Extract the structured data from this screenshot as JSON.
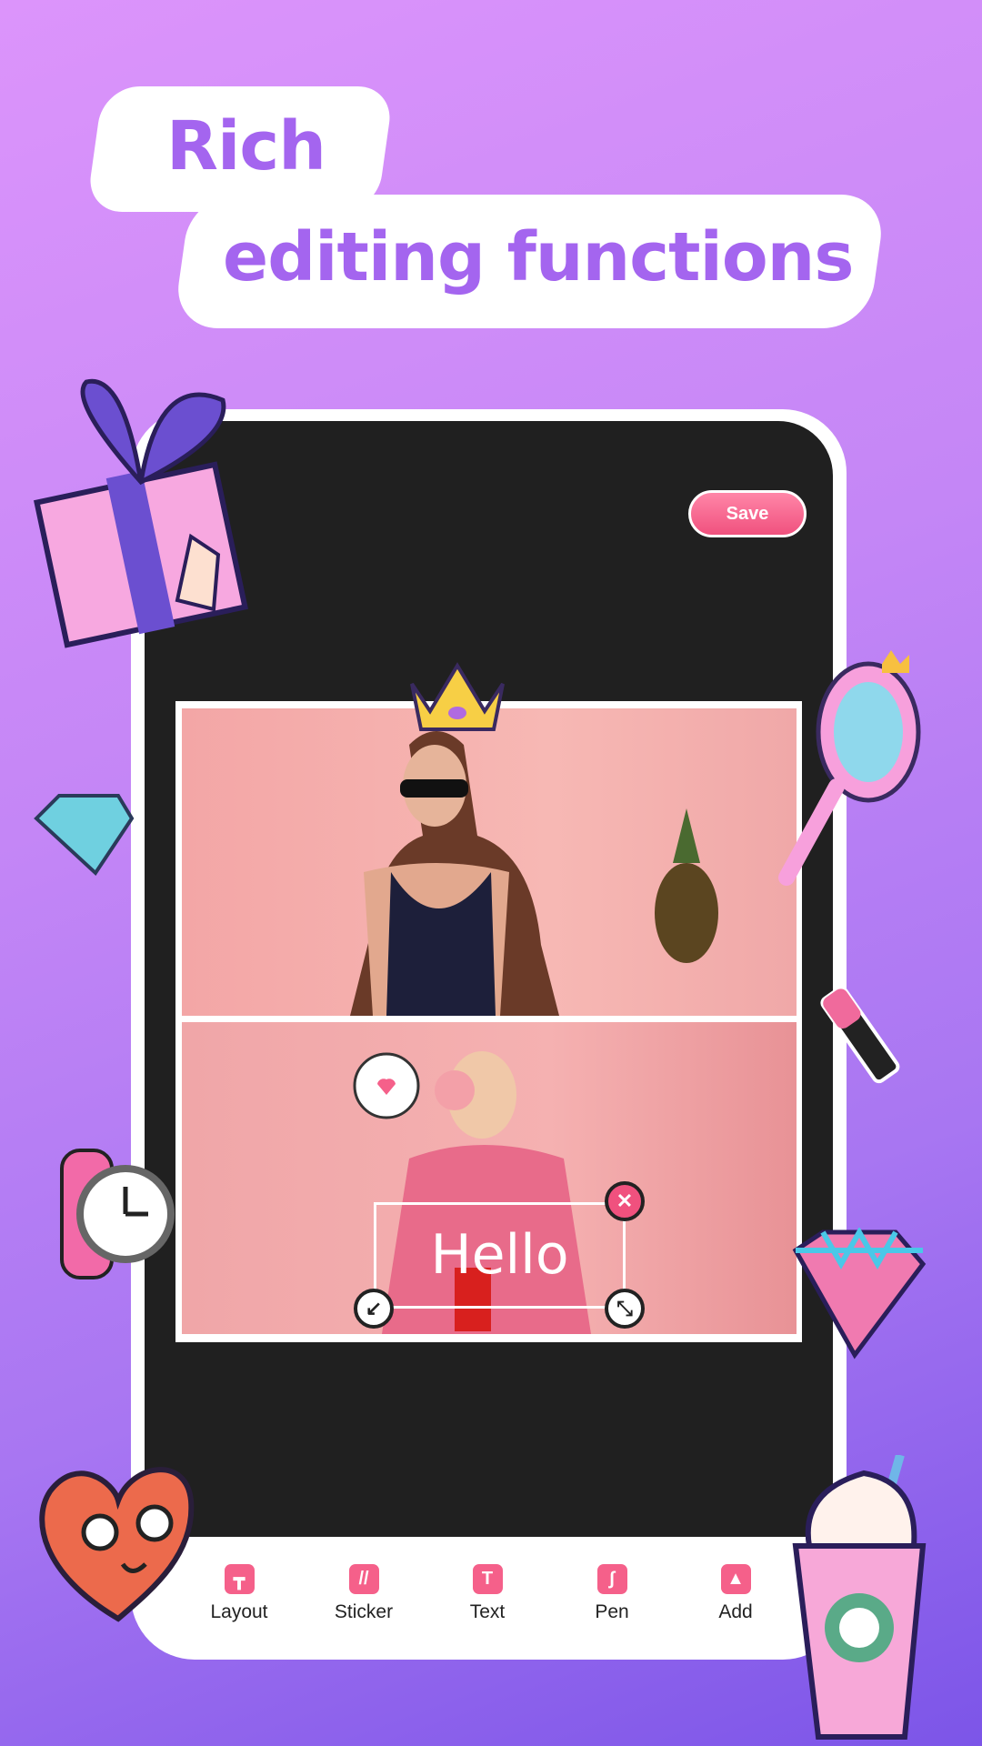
{
  "headline": {
    "line1": "Rich",
    "line2": "editing functions"
  },
  "editor": {
    "save_label": "Save",
    "text_sticker": "Hello",
    "toolbar": [
      {
        "label": "Layout",
        "icon": "layout-icon"
      },
      {
        "label": "Sticker",
        "icon": "sticker-icon"
      },
      {
        "label": "Text",
        "icon": "text-icon"
      },
      {
        "label": "Pen",
        "icon": "pen-icon"
      },
      {
        "label": "Add",
        "icon": "image-add-icon"
      }
    ]
  },
  "colors": {
    "accent": "#f5608a",
    "headline": "#a465ef",
    "screen": "#202020"
  }
}
